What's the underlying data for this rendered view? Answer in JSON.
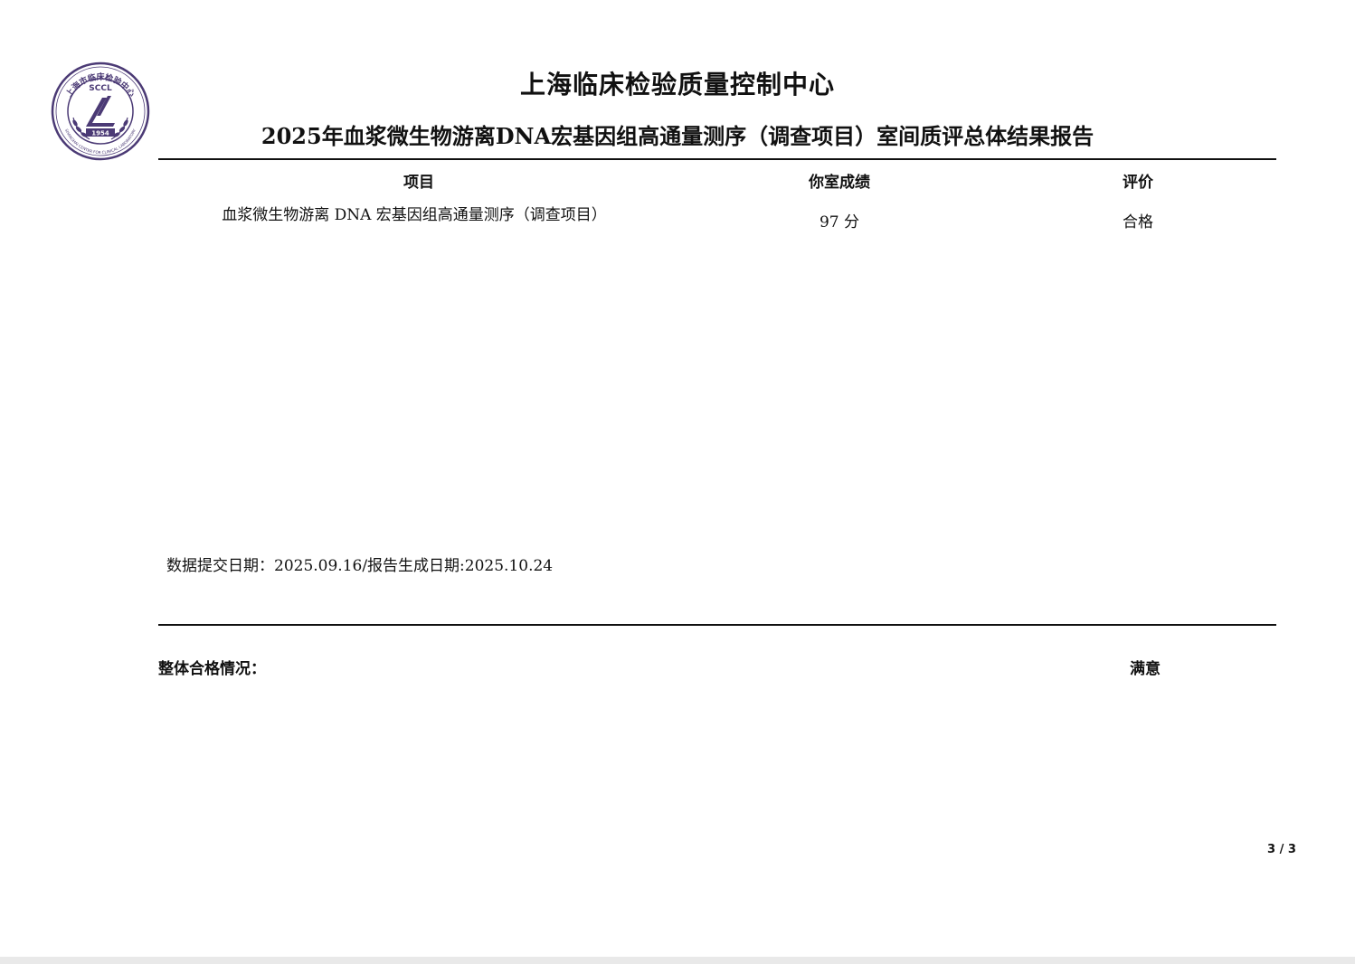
{
  "logo": {
    "abbr": "SCCL",
    "year": "1954",
    "ring_cn": "上海市临床检验中心",
    "ring_en": "SHANGHAI CENTER FOR CLINICAL LABORATORY",
    "color": "#4b3a75"
  },
  "header": {
    "title": "上海临床检验质量控制中心",
    "subtitle": "2025年血浆微生物游离DNA宏基因组高通量测序（调查项目）室间质评总体结果报告"
  },
  "table": {
    "columns": [
      "项目",
      "你室成绩",
      "评价"
    ],
    "rows": [
      {
        "item": "血浆微生物游离 DNA 宏基因组高通量测序（调查项目）",
        "score": "97 分",
        "evaluation": "合格"
      }
    ]
  },
  "dates_line": "数据提交日期：2025.09.16/报告生成日期:2025.10.24",
  "overall": {
    "label": "整体合格情况：",
    "value": "满意"
  },
  "page_number": "3 / 3"
}
